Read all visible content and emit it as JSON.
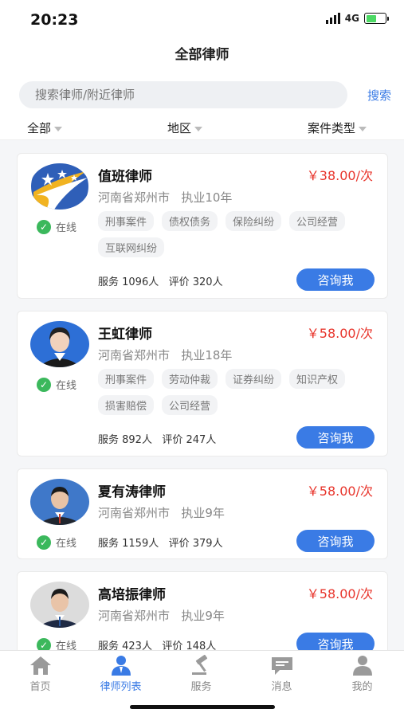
{
  "status": {
    "time": "20:23",
    "network": "4G"
  },
  "nav": {
    "title": "全部律师"
  },
  "search": {
    "placeholder": "搜索律师/附近律师",
    "button": "搜索"
  },
  "filters": [
    "全部",
    "地区",
    "案件类型"
  ],
  "lawyers": [
    {
      "name": "值班律师",
      "price": "￥38.00/次",
      "location": "河南省郑州市",
      "experience": "执业10年",
      "tags": [
        "刑事案件",
        "债权债务",
        "保险纠纷",
        "公司经营",
        "互联网纠纷"
      ],
      "served": "服务 1096人",
      "rating": "评价 320人",
      "status": "在线",
      "action": "咨询我",
      "avatar": "logo"
    },
    {
      "name": "王虹律师",
      "price": "￥58.00/次",
      "location": "河南省郑州市",
      "experience": "执业18年",
      "tags": [
        "刑事案件",
        "劳动仲裁",
        "证券纠纷",
        "知识产权",
        "损害赔偿",
        "公司经营"
      ],
      "served": "服务 892人",
      "rating": "评价 247人",
      "status": "在线",
      "action": "咨询我",
      "avatar": "photo"
    },
    {
      "name": "夏有涛律师",
      "price": "￥58.00/次",
      "location": "河南省郑州市",
      "experience": "执业9年",
      "tags": [],
      "served": "服务 1159人",
      "rating": "评价 379人",
      "status": "在线",
      "action": "咨询我",
      "avatar": "photo"
    },
    {
      "name": "高培振律师",
      "price": "￥58.00/次",
      "location": "河南省郑州市",
      "experience": "执业9年",
      "tags": [],
      "served": "服务 423人",
      "rating": "评价 148人",
      "status": "在线",
      "action": "咨询我",
      "avatar": "photo"
    }
  ],
  "tabs": [
    {
      "label": "首页",
      "icon": "home-icon",
      "active": false
    },
    {
      "label": "律师列表",
      "icon": "lawyer-icon",
      "active": true
    },
    {
      "label": "服务",
      "icon": "gavel-icon",
      "active": false
    },
    {
      "label": "消息",
      "icon": "message-icon",
      "active": false
    },
    {
      "label": "我的",
      "icon": "user-icon",
      "active": false
    }
  ],
  "colors": {
    "accent": "#3a7be5",
    "price": "#e8352c",
    "online": "#3bb85c"
  }
}
